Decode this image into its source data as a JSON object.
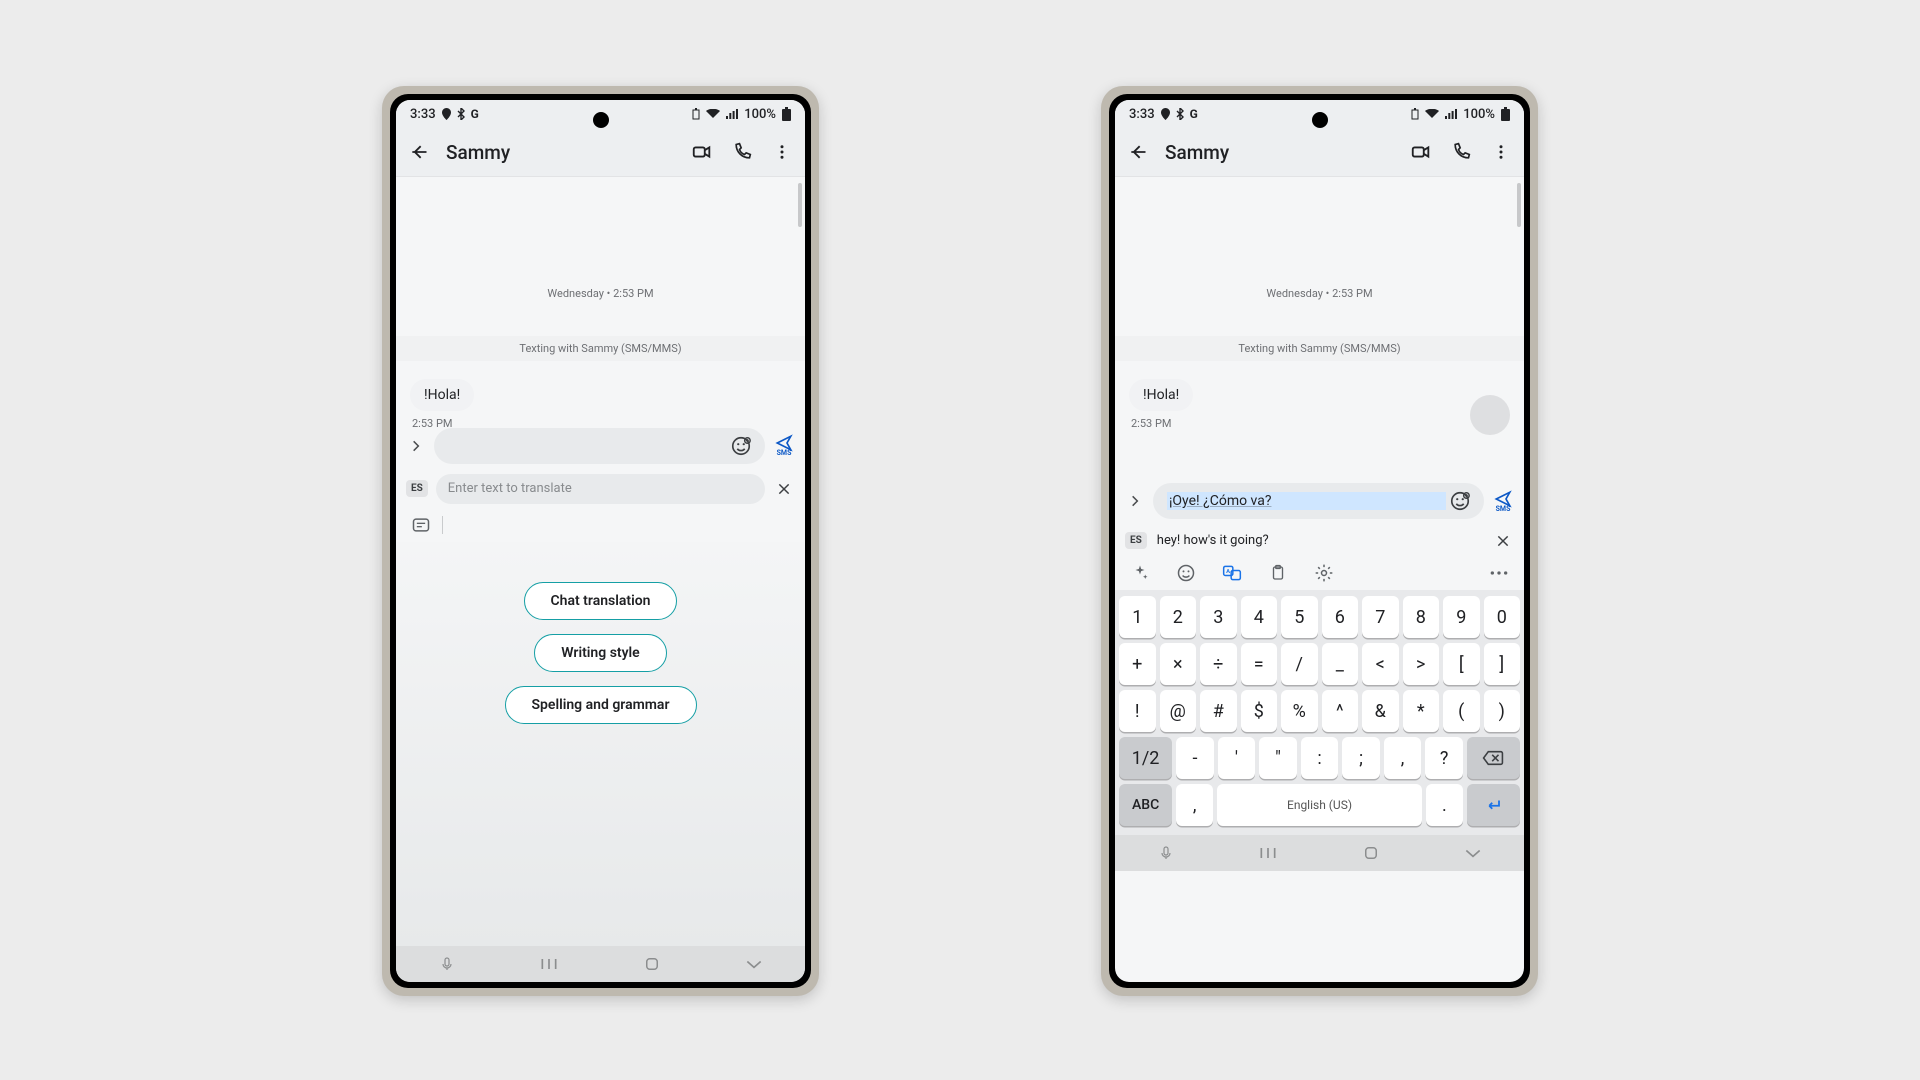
{
  "status": {
    "time": "3:33",
    "battery_text": "100%"
  },
  "header": {
    "contact": "Sammy"
  },
  "conversation": {
    "day_stamp": "Wednesday • 2:53 PM",
    "texting_with": "Texting with Sammy (SMS/MMS)",
    "message": {
      "text": "!Hola!",
      "time": "2:53 PM"
    }
  },
  "left": {
    "compose_value": "",
    "translate_placeholder": "Enter text to translate",
    "lang_badge": "ES",
    "suggestions": [
      "Chat translation",
      "Writing style",
      "Spelling and grammar"
    ]
  },
  "right": {
    "compose_value": "¡Oye! ¿Cómo va?",
    "lang_badge": "ES",
    "translate_value": "hey! how's it going?",
    "keyboard": {
      "row1": [
        "1",
        "2",
        "3",
        "4",
        "5",
        "6",
        "7",
        "8",
        "9",
        "0"
      ],
      "row2": [
        "+",
        "×",
        "÷",
        "=",
        "/",
        "_",
        "<",
        ">",
        "[",
        "]"
      ],
      "row3": [
        "!",
        "@",
        "#",
        "$",
        "%",
        "^",
        "&",
        "*",
        "(",
        ")"
      ],
      "row4_toggle": "1/2",
      "row4": [
        "-",
        "'",
        "\"",
        ":",
        ";",
        ",",
        "?"
      ],
      "row5_abc": "ABC",
      "row5_comma": ",",
      "row5_space": "English (US)",
      "row5_period": "."
    }
  },
  "send_label": "SMS"
}
